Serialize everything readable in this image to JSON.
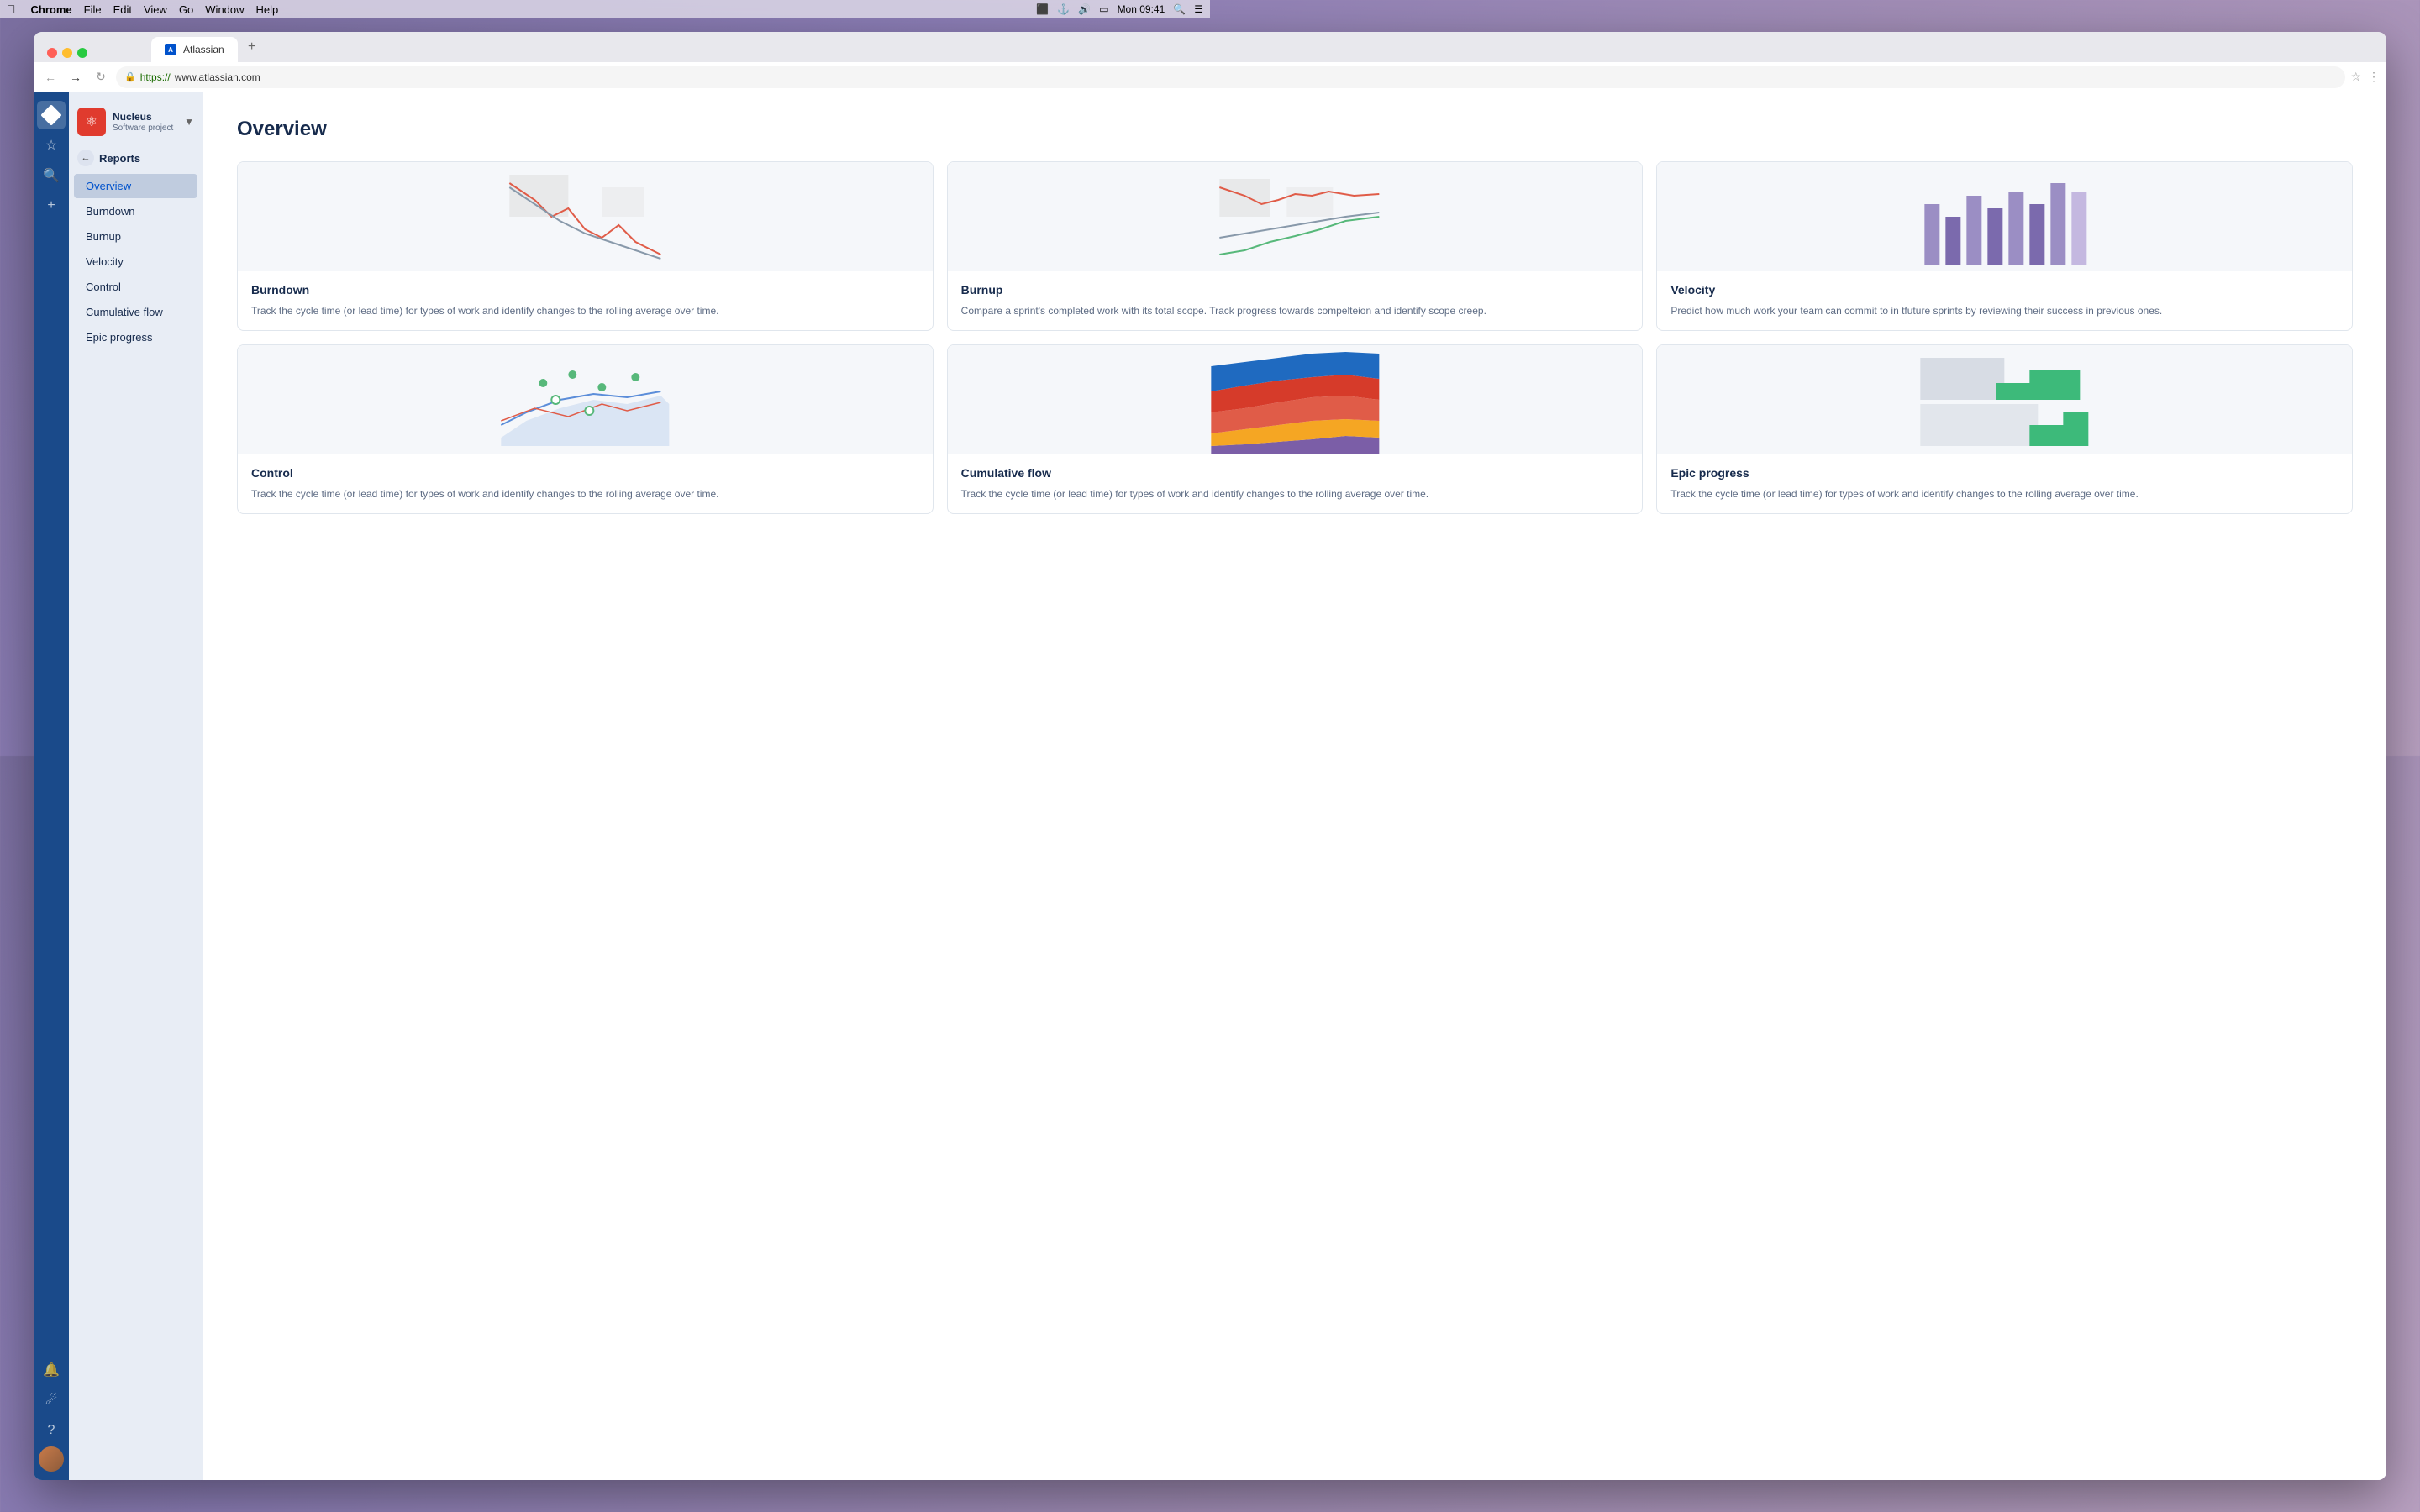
{
  "menubar": {
    "apple": "&#xF8FF;",
    "chrome": "Chrome",
    "file": "File",
    "edit": "Edit",
    "view": "View",
    "go": "Go",
    "window": "Window",
    "help": "Help",
    "time": "Mon 09:41"
  },
  "browser": {
    "tab_label": "Atlassian",
    "url_https": "https://",
    "url_domain": "www.atlassian.com"
  },
  "sidebar": {
    "project_name": "Nucleus",
    "project_type": "Software project"
  },
  "nav": {
    "back_section": "Reports",
    "items": [
      {
        "id": "overview",
        "label": "Overview",
        "active": true
      },
      {
        "id": "burndown",
        "label": "Burndown",
        "active": false
      },
      {
        "id": "burnup",
        "label": "Burnup",
        "active": false
      },
      {
        "id": "velocity",
        "label": "Velocity",
        "active": false
      },
      {
        "id": "control",
        "label": "Control",
        "active": false
      },
      {
        "id": "cumulative-flow",
        "label": "Cumulative flow",
        "active": false
      },
      {
        "id": "epic-progress",
        "label": "Epic progress",
        "active": false
      }
    ]
  },
  "page": {
    "title": "Overview",
    "cards": [
      {
        "id": "burndown",
        "title": "Burndown",
        "description": "Track the cycle time (or lead time) for types of work and identify changes to the rolling average over time.",
        "chart_type": "burndown"
      },
      {
        "id": "burnup",
        "title": "Burnup",
        "description": "Compare a sprint's completed work with its total scope. Track progress towards compelteion and identify scope creep.",
        "chart_type": "burnup"
      },
      {
        "id": "velocity",
        "title": "Velocity",
        "description": "Predict how much work your team can commit to in tfuture sprints by reviewing their success in previous ones.",
        "chart_type": "velocity"
      },
      {
        "id": "control",
        "title": "Control",
        "description": "Track the cycle time (or lead time) for types of work and identify changes to the rolling average over time.",
        "chart_type": "control"
      },
      {
        "id": "cumulative-flow",
        "title": "Cumulative flow",
        "description": "Track the cycle time (or lead time) for types of work and identify changes to the rolling average over time.",
        "chart_type": "cumflow"
      },
      {
        "id": "epic-progress",
        "title": "Epic progress",
        "description": "Track the cycle time (or lead time) for types of work and identify changes to the rolling average over time.",
        "chart_type": "epic"
      }
    ]
  }
}
